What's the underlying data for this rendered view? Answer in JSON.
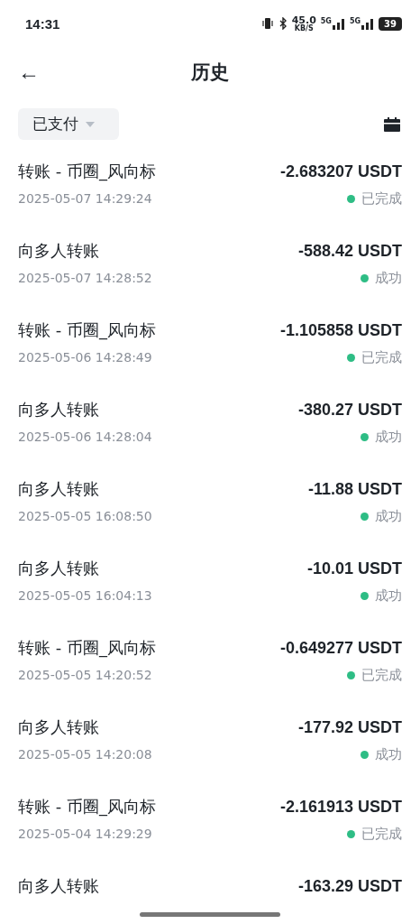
{
  "status_bar": {
    "time": "14:31",
    "speed": "45.0",
    "speed_unit": "KB/S",
    "network_1": "5G",
    "network_2": "5G",
    "battery": "39"
  },
  "header": {
    "back": "←",
    "title": "历史"
  },
  "filter": {
    "label": "已支付"
  },
  "transactions": [
    {
      "title": "转账 - 币圈_风向标",
      "time": "2025-05-07 14:29:24",
      "amount": "-2.683207 USDT",
      "status": "已完成"
    },
    {
      "title": "向多人转账",
      "time": "2025-05-07 14:28:52",
      "amount": "-588.42 USDT",
      "status": "成功"
    },
    {
      "title": "转账 - 币圈_风向标",
      "time": "2025-05-06 14:28:49",
      "amount": "-1.105858 USDT",
      "status": "已完成"
    },
    {
      "title": "向多人转账",
      "time": "2025-05-06 14:28:04",
      "amount": "-380.27 USDT",
      "status": "成功"
    },
    {
      "title": "向多人转账",
      "time": "2025-05-05 16:08:50",
      "amount": "-11.88 USDT",
      "status": "成功"
    },
    {
      "title": "向多人转账",
      "time": "2025-05-05 16:04:13",
      "amount": "-10.01 USDT",
      "status": "成功"
    },
    {
      "title": "转账 - 币圈_风向标",
      "time": "2025-05-05 14:20:52",
      "amount": "-0.649277 USDT",
      "status": "已完成"
    },
    {
      "title": "向多人转账",
      "time": "2025-05-05 14:20:08",
      "amount": "-177.92 USDT",
      "status": "成功"
    },
    {
      "title": "转账 - 币圈_风向标",
      "time": "2025-05-04 14:29:29",
      "amount": "-2.161913 USDT",
      "status": "已完成"
    },
    {
      "title": "向多人转账",
      "amount": "-163.29 USDT"
    }
  ]
}
